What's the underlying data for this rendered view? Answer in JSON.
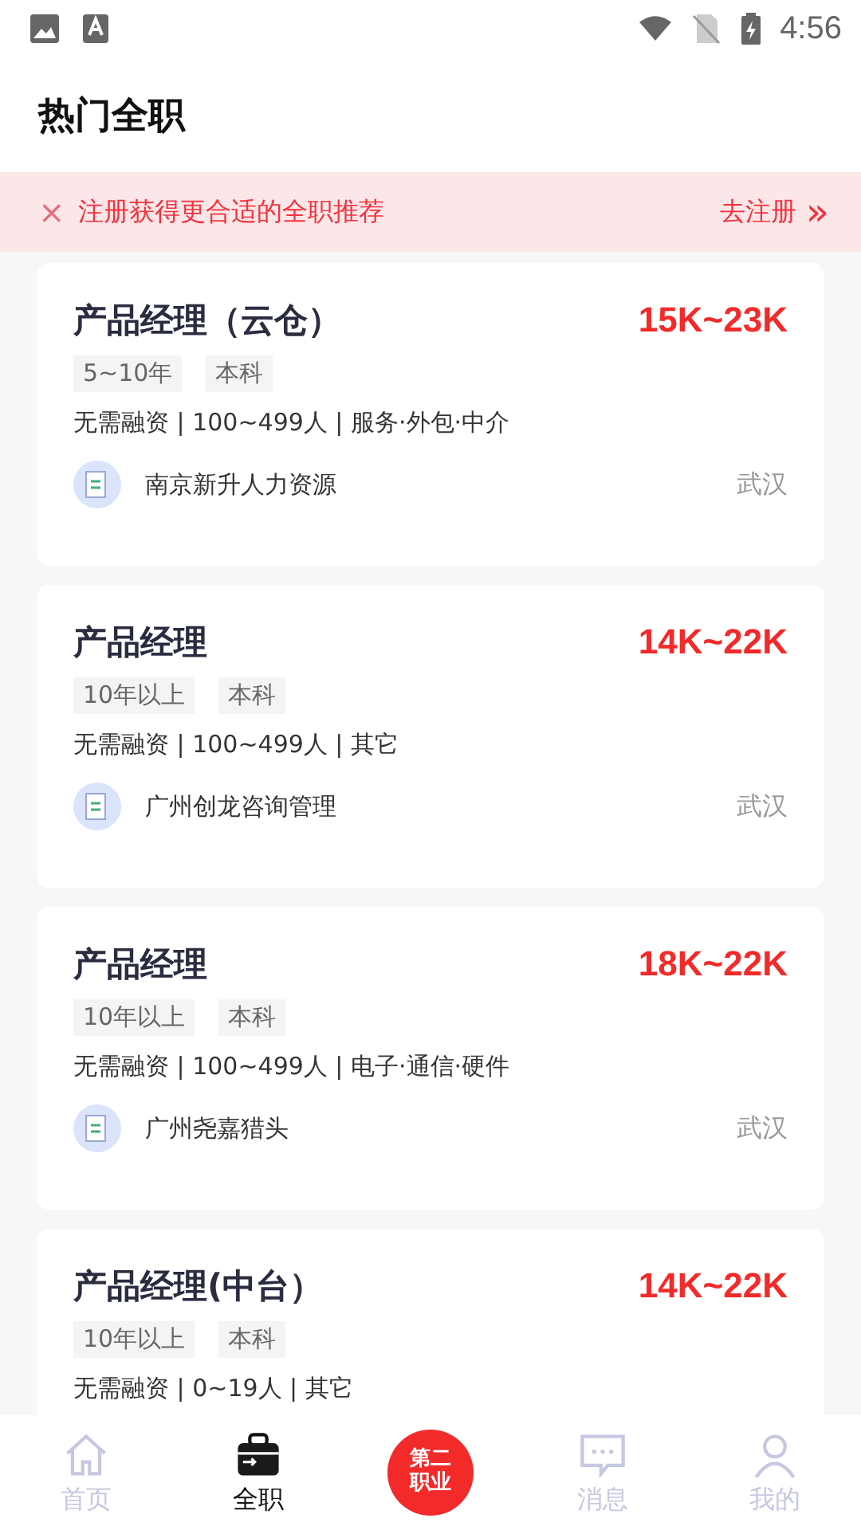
{
  "status_bar": {
    "time": "4:56"
  },
  "header": {
    "title": "热门全职"
  },
  "banner": {
    "close": "×",
    "text": "注册获得更合适的全职推荐",
    "action": "去注册",
    "action_icon": "»"
  },
  "jobs": [
    {
      "title": "产品经理（云仓）",
      "salary": "15K~23K",
      "tags": [
        "5~10年",
        "本科"
      ],
      "info": "无需融资 | 100~499人 | 服务·外包·中介",
      "company": "南京新升人力资源",
      "city": "武汉"
    },
    {
      "title": "产品经理",
      "salary": "14K~22K",
      "tags": [
        "10年以上",
        "本科"
      ],
      "info": "无需融资 | 100~499人 | 其它",
      "company": "广州创龙咨询管理",
      "city": "武汉"
    },
    {
      "title": "产品经理",
      "salary": "18K~22K",
      "tags": [
        "10年以上",
        "本科"
      ],
      "info": "无需融资 | 100~499人 | 电子·通信·硬件",
      "company": "广州尧嘉猎头",
      "city": "武汉"
    },
    {
      "title": "产品经理(中台）",
      "salary": "14K~22K",
      "tags": [
        "10年以上",
        "本科"
      ],
      "info": "无需融资 | 0~19人 | 其它"
    }
  ],
  "nav": [
    {
      "kind": "home",
      "label": "首页",
      "selected": false
    },
    {
      "kind": "briefcase",
      "label": "全职",
      "selected": true
    },
    {
      "kind": "logo",
      "lines": [
        "第二",
        "职业"
      ]
    },
    {
      "kind": "message",
      "label": "消息",
      "selected": false
    },
    {
      "kind": "person",
      "label": "我的",
      "selected": false
    }
  ]
}
